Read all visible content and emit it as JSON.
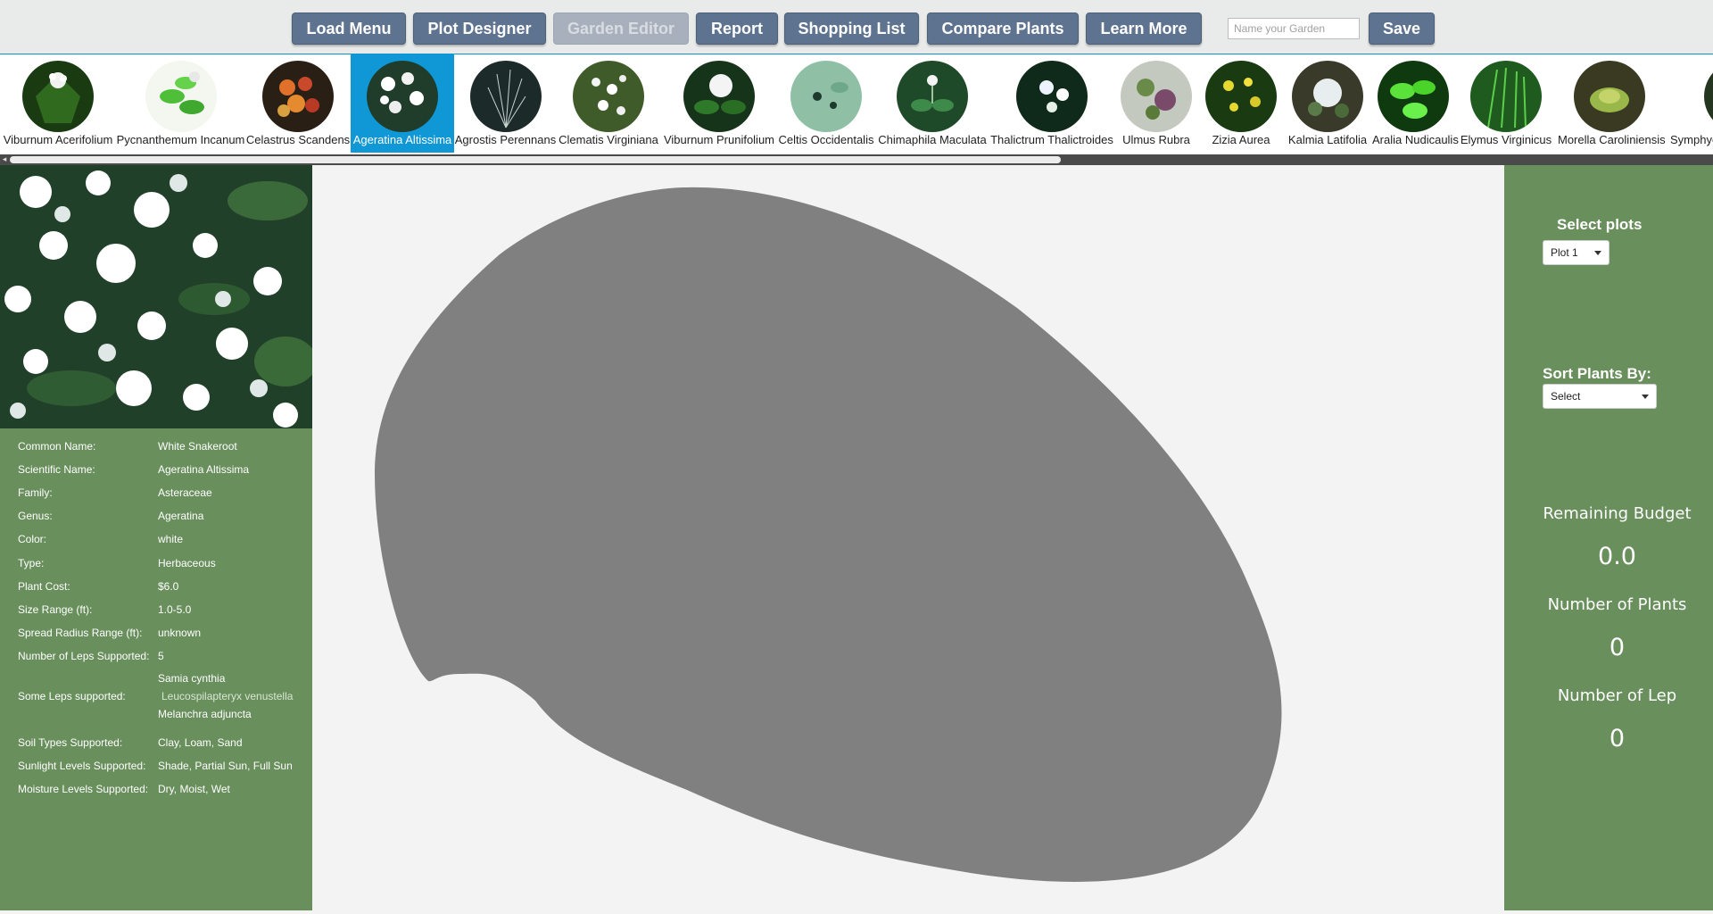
{
  "toolbar": {
    "buttons": [
      "Load Menu",
      "Plot Designer",
      "Garden Editor",
      "Report",
      "Shopping List",
      "Compare Plants",
      "Learn More"
    ],
    "garden_name_placeholder": "Name your Garden",
    "save_label": "Save"
  },
  "plants": [
    {
      "name": "Viburnum Acerifolium"
    },
    {
      "name": "Pycnanthemum Incanum"
    },
    {
      "name": "Celastrus Scandens"
    },
    {
      "name": "Ageratina Altissima"
    },
    {
      "name": "Agrostis Perennans"
    },
    {
      "name": "Clematis Virginiana"
    },
    {
      "name": "Viburnum Prunifolium"
    },
    {
      "name": "Celtis Occidentalis"
    },
    {
      "name": "Chimaphila Maculata"
    },
    {
      "name": "Thalictrum Thalictroides"
    },
    {
      "name": "Ulmus Rubra"
    },
    {
      "name": "Zizia Aurea"
    },
    {
      "name": "Kalmia Latifolia"
    },
    {
      "name": "Aralia Nudicaulis"
    },
    {
      "name": "Elymus Virginicus"
    },
    {
      "name": "Morella Caroliniensis"
    },
    {
      "name": "Symphyc"
    }
  ],
  "selected_plant": "Ageratina Altissima",
  "info": {
    "rows": [
      {
        "label": "Common Name:",
        "value": "White Snakeroot"
      },
      {
        "label": "Scientific Name:",
        "value": "Ageratina Altissima"
      },
      {
        "label": "Family:",
        "value": "Asteraceae"
      },
      {
        "label": "Genus:",
        "value": "Ageratina"
      },
      {
        "label": "Color:",
        "value": "white"
      },
      {
        "label": "Type:",
        "value": "Herbaceous"
      },
      {
        "label": "Plant Cost:",
        "value": "$6.0"
      },
      {
        "label": "Size Range (ft):",
        "value": "1.0-5.0"
      },
      {
        "label": "Spread Radius Range (ft):",
        "value": "unknown"
      },
      {
        "label": "Number of Leps Supported:",
        "value": "5"
      }
    ],
    "leps_label": "Some Leps supported:",
    "leps": [
      "Samia cynthia",
      "Leucospilapteryx venustella",
      "Melanchra adjuncta"
    ],
    "rows2": [
      {
        "label": "Soil Types Supported:",
        "value": "Clay, Loam, Sand"
      },
      {
        "label": "Sunlight Levels Supported:",
        "value": "Shade, Partial Sun, Full Sun"
      },
      {
        "label": "Moisture Levels Supported:",
        "value": "Dry, Moist, Wet"
      }
    ]
  },
  "right": {
    "select_plots_label": "Select plots",
    "plot_value": "Plot 1",
    "sort_label": "Sort Plants By:",
    "sort_value": "Select",
    "budget_label": "Remaining Budget",
    "budget_value": "0.0",
    "plants_label": "Number of Plants",
    "plants_value": "0",
    "lep_label": "Number of Lep",
    "lep_value": "0"
  },
  "colors": {
    "panel_green": "#688f5c",
    "button_blue": "#5e7390",
    "selected_blue": "#0f97d6",
    "plot_gray": "#808080"
  }
}
